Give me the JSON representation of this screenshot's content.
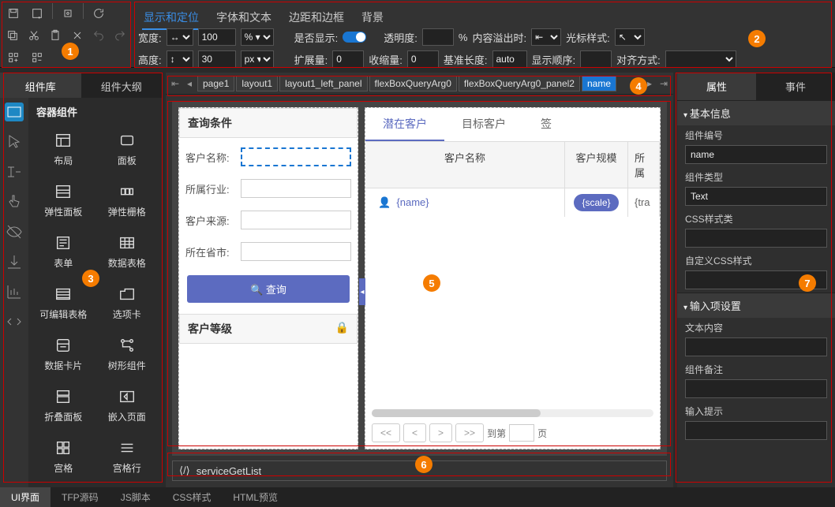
{
  "top_tabs": [
    "显示和定位",
    "字体和文本",
    "边距和边框",
    "背景"
  ],
  "props": {
    "width_label": "宽度:",
    "width_val": "100",
    "width_unit": "% ▾",
    "height_label": "高度:",
    "height_val": "30",
    "height_unit": "px ▾",
    "display_label": "是否显示:",
    "opacity_label": "透明度:",
    "opacity_unit": "%",
    "overflow_label": "内容溢出时:",
    "cursor_label": "光标样式:",
    "expand_label": "扩展量:",
    "expand_val": "0",
    "shrink_label": "收缩量:",
    "shrink_val": "0",
    "basis_label": "基准长度:",
    "basis_val": "auto",
    "order_label": "显示顺序:",
    "align_label": "对齐方式:"
  },
  "left_tabs": [
    "组件库",
    "组件大纲"
  ],
  "comp_header": "容器组件",
  "components": [
    "布局",
    "面板",
    "弹性面板",
    "弹性栅格",
    "表单",
    "数据表格",
    "可编辑表格",
    "选项卡",
    "数据卡片",
    "树形组件",
    "折叠面板",
    "嵌入页面",
    "宫格",
    "宫格行"
  ],
  "breadcrumb": [
    "page1",
    "layout1",
    "layout1_left_panel",
    "flexBoxQueryArg0",
    "flexBoxQueryArg0_panel2",
    "name"
  ],
  "canvas": {
    "query_title": "查询条件",
    "fields": [
      "客户名称:",
      "所属行业:",
      "客户来源:",
      "所在省市:"
    ],
    "query_btn": "查询",
    "level_title": "客户等级",
    "tabs": [
      "潜在客户",
      "目标客户",
      "签"
    ],
    "table_headers": [
      "客户名称",
      "客户规模",
      "所属"
    ],
    "row_name": "{name}",
    "row_scale": "{scale}",
    "row_tra": "{tra",
    "pager_to": "到第",
    "pager_page": "页"
  },
  "service": "serviceGetList",
  "right_tabs": [
    "属性",
    "事件"
  ],
  "rp": {
    "section1": "基本信息",
    "id_label": "组件编号",
    "id_val": "name",
    "type_label": "组件类型",
    "type_val": "Text",
    "css_label": "CSS样式类",
    "custom_css_label": "自定义CSS样式",
    "section2": "输入项设置",
    "content_label": "文本内容",
    "remark_label": "组件备注",
    "hint_label": "输入提示"
  },
  "bottom_tabs": [
    "UI界面",
    "TFP源码",
    "JS脚本",
    "CSS样式",
    "HTML预览"
  ]
}
